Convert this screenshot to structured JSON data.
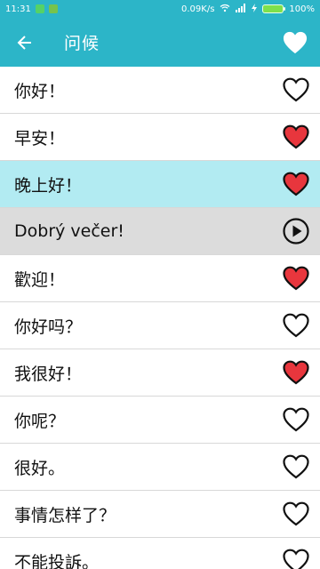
{
  "status_bar": {
    "time": "11:31",
    "speed": "0.09K/s",
    "battery": "100%",
    "icons": [
      "notification-icon",
      "notification-icon-2",
      "wifi-icon",
      "signal-icon",
      "charging-icon",
      "battery-icon"
    ]
  },
  "app_bar": {
    "title": "问候",
    "back_icon": "arrow-left-icon",
    "favorite_icon": "heart-filled-icon"
  },
  "colors": {
    "primary": "#2cb5c8",
    "selected_row": "#b2ebf2",
    "playing_row": "#dcdcdc",
    "heart_red": "#e8363d"
  },
  "phrases": [
    {
      "text": "你好！",
      "favorite": false
    },
    {
      "text": "早安！",
      "favorite": true
    },
    {
      "text": "晚上好！",
      "favorite": true,
      "selected": true
    },
    {
      "text": "Dobrý večer!",
      "playing": true
    },
    {
      "text": "歡迎！",
      "favorite": true
    },
    {
      "text": "你好吗？",
      "favorite": false
    },
    {
      "text": "我很好！",
      "favorite": true
    },
    {
      "text": "你呢？",
      "favorite": false
    },
    {
      "text": "很好。",
      "favorite": false
    },
    {
      "text": "事情怎样了？",
      "favorite": false
    },
    {
      "text": "不能投訴。",
      "favorite": false
    }
  ]
}
